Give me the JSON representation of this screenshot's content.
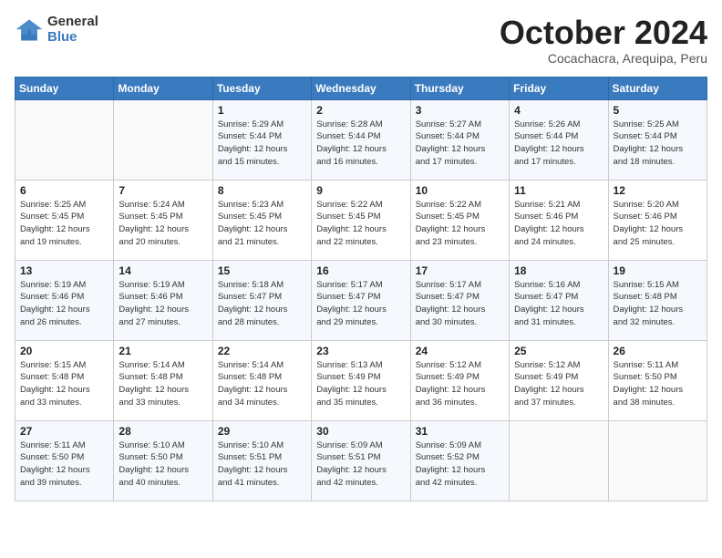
{
  "logo": {
    "general": "General",
    "blue": "Blue"
  },
  "header": {
    "month": "October 2024",
    "location": "Cocachacra, Arequipa, Peru"
  },
  "weekdays": [
    "Sunday",
    "Monday",
    "Tuesday",
    "Wednesday",
    "Thursday",
    "Friday",
    "Saturday"
  ],
  "weeks": [
    [
      {
        "day": "",
        "sunrise": "",
        "sunset": "",
        "daylight": ""
      },
      {
        "day": "",
        "sunrise": "",
        "sunset": "",
        "daylight": ""
      },
      {
        "day": "1",
        "sunrise": "Sunrise: 5:29 AM",
        "sunset": "Sunset: 5:44 PM",
        "daylight": "Daylight: 12 hours and 15 minutes."
      },
      {
        "day": "2",
        "sunrise": "Sunrise: 5:28 AM",
        "sunset": "Sunset: 5:44 PM",
        "daylight": "Daylight: 12 hours and 16 minutes."
      },
      {
        "day": "3",
        "sunrise": "Sunrise: 5:27 AM",
        "sunset": "Sunset: 5:44 PM",
        "daylight": "Daylight: 12 hours and 17 minutes."
      },
      {
        "day": "4",
        "sunrise": "Sunrise: 5:26 AM",
        "sunset": "Sunset: 5:44 PM",
        "daylight": "Daylight: 12 hours and 17 minutes."
      },
      {
        "day": "5",
        "sunrise": "Sunrise: 5:25 AM",
        "sunset": "Sunset: 5:44 PM",
        "daylight": "Daylight: 12 hours and 18 minutes."
      }
    ],
    [
      {
        "day": "6",
        "sunrise": "Sunrise: 5:25 AM",
        "sunset": "Sunset: 5:45 PM",
        "daylight": "Daylight: 12 hours and 19 minutes."
      },
      {
        "day": "7",
        "sunrise": "Sunrise: 5:24 AM",
        "sunset": "Sunset: 5:45 PM",
        "daylight": "Daylight: 12 hours and 20 minutes."
      },
      {
        "day": "8",
        "sunrise": "Sunrise: 5:23 AM",
        "sunset": "Sunset: 5:45 PM",
        "daylight": "Daylight: 12 hours and 21 minutes."
      },
      {
        "day": "9",
        "sunrise": "Sunrise: 5:22 AM",
        "sunset": "Sunset: 5:45 PM",
        "daylight": "Daylight: 12 hours and 22 minutes."
      },
      {
        "day": "10",
        "sunrise": "Sunrise: 5:22 AM",
        "sunset": "Sunset: 5:45 PM",
        "daylight": "Daylight: 12 hours and 23 minutes."
      },
      {
        "day": "11",
        "sunrise": "Sunrise: 5:21 AM",
        "sunset": "Sunset: 5:46 PM",
        "daylight": "Daylight: 12 hours and 24 minutes."
      },
      {
        "day": "12",
        "sunrise": "Sunrise: 5:20 AM",
        "sunset": "Sunset: 5:46 PM",
        "daylight": "Daylight: 12 hours and 25 minutes."
      }
    ],
    [
      {
        "day": "13",
        "sunrise": "Sunrise: 5:19 AM",
        "sunset": "Sunset: 5:46 PM",
        "daylight": "Daylight: 12 hours and 26 minutes."
      },
      {
        "day": "14",
        "sunrise": "Sunrise: 5:19 AM",
        "sunset": "Sunset: 5:46 PM",
        "daylight": "Daylight: 12 hours and 27 minutes."
      },
      {
        "day": "15",
        "sunrise": "Sunrise: 5:18 AM",
        "sunset": "Sunset: 5:47 PM",
        "daylight": "Daylight: 12 hours and 28 minutes."
      },
      {
        "day": "16",
        "sunrise": "Sunrise: 5:17 AM",
        "sunset": "Sunset: 5:47 PM",
        "daylight": "Daylight: 12 hours and 29 minutes."
      },
      {
        "day": "17",
        "sunrise": "Sunrise: 5:17 AM",
        "sunset": "Sunset: 5:47 PM",
        "daylight": "Daylight: 12 hours and 30 minutes."
      },
      {
        "day": "18",
        "sunrise": "Sunrise: 5:16 AM",
        "sunset": "Sunset: 5:47 PM",
        "daylight": "Daylight: 12 hours and 31 minutes."
      },
      {
        "day": "19",
        "sunrise": "Sunrise: 5:15 AM",
        "sunset": "Sunset: 5:48 PM",
        "daylight": "Daylight: 12 hours and 32 minutes."
      }
    ],
    [
      {
        "day": "20",
        "sunrise": "Sunrise: 5:15 AM",
        "sunset": "Sunset: 5:48 PM",
        "daylight": "Daylight: 12 hours and 33 minutes."
      },
      {
        "day": "21",
        "sunrise": "Sunrise: 5:14 AM",
        "sunset": "Sunset: 5:48 PM",
        "daylight": "Daylight: 12 hours and 33 minutes."
      },
      {
        "day": "22",
        "sunrise": "Sunrise: 5:14 AM",
        "sunset": "Sunset: 5:48 PM",
        "daylight": "Daylight: 12 hours and 34 minutes."
      },
      {
        "day": "23",
        "sunrise": "Sunrise: 5:13 AM",
        "sunset": "Sunset: 5:49 PM",
        "daylight": "Daylight: 12 hours and 35 minutes."
      },
      {
        "day": "24",
        "sunrise": "Sunrise: 5:12 AM",
        "sunset": "Sunset: 5:49 PM",
        "daylight": "Daylight: 12 hours and 36 minutes."
      },
      {
        "day": "25",
        "sunrise": "Sunrise: 5:12 AM",
        "sunset": "Sunset: 5:49 PM",
        "daylight": "Daylight: 12 hours and 37 minutes."
      },
      {
        "day": "26",
        "sunrise": "Sunrise: 5:11 AM",
        "sunset": "Sunset: 5:50 PM",
        "daylight": "Daylight: 12 hours and 38 minutes."
      }
    ],
    [
      {
        "day": "27",
        "sunrise": "Sunrise: 5:11 AM",
        "sunset": "Sunset: 5:50 PM",
        "daylight": "Daylight: 12 hours and 39 minutes."
      },
      {
        "day": "28",
        "sunrise": "Sunrise: 5:10 AM",
        "sunset": "Sunset: 5:50 PM",
        "daylight": "Daylight: 12 hours and 40 minutes."
      },
      {
        "day": "29",
        "sunrise": "Sunrise: 5:10 AM",
        "sunset": "Sunset: 5:51 PM",
        "daylight": "Daylight: 12 hours and 41 minutes."
      },
      {
        "day": "30",
        "sunrise": "Sunrise: 5:09 AM",
        "sunset": "Sunset: 5:51 PM",
        "daylight": "Daylight: 12 hours and 42 minutes."
      },
      {
        "day": "31",
        "sunrise": "Sunrise: 5:09 AM",
        "sunset": "Sunset: 5:52 PM",
        "daylight": "Daylight: 12 hours and 42 minutes."
      },
      {
        "day": "",
        "sunrise": "",
        "sunset": "",
        "daylight": ""
      },
      {
        "day": "",
        "sunrise": "",
        "sunset": "",
        "daylight": ""
      }
    ]
  ]
}
